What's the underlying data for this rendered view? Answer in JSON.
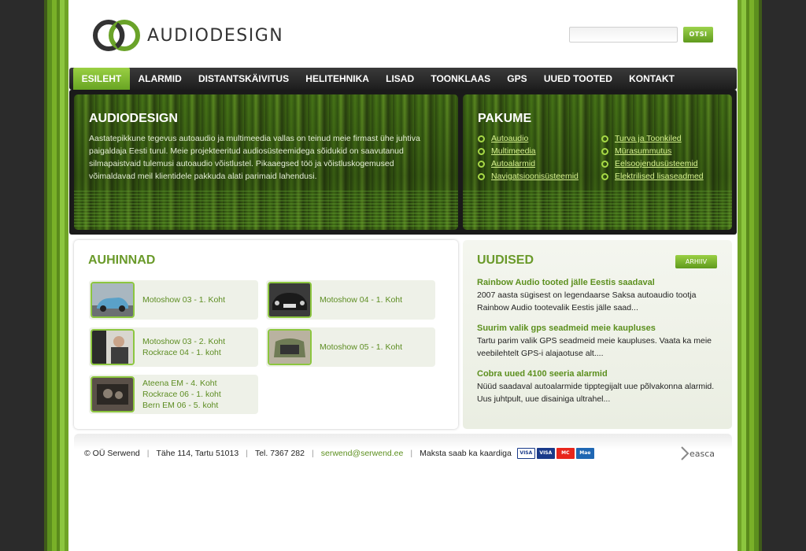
{
  "site": {
    "logo_text": "AUDIODESIGN",
    "search": {
      "placeholder": "",
      "button_label": "OTSI"
    }
  },
  "nav": {
    "items": [
      "ESILEHT",
      "ALARMID",
      "DISTANTSKÄIVITUS",
      "HELITEHNIKA",
      "LISAD",
      "TOONKLAAS",
      "GPS",
      "UUED TOOTED",
      "KONTAKT"
    ],
    "active": "ESILEHT"
  },
  "intro": {
    "title": "AUDIODESIGN",
    "text": "Aastatepikkune tegevus autoaudio ja multimeedia vallas on teinud meie firmast ühe juhtiva paigaldaja Eesti turul. Meie projekteeritud audiosüsteemidega sõidukid on saavutanud silmapaistvaid tulemusi autoaudio võistlustel. Pikaaegsed töö ja võistluskogemused võimaldavad meil klientidele pakkuda alati parimaid lahendusi."
  },
  "offers": {
    "title": "PAKUME",
    "items": [
      "Autoaudio",
      "Turva ja Toonkiled",
      "Multimeedia",
      "Mürasummutus",
      "Autoalarmid",
      "Eelsoojendusüsteemid",
      "Navigatsioonisüsteemid",
      "Elektrilised lisaseadmed"
    ]
  },
  "awards": {
    "title": "AUHINNAD",
    "items": [
      {
        "lines": [
          "Motoshow 03 - 1. Koht"
        ]
      },
      {
        "lines": [
          "Motoshow 04 - 1. Koht"
        ]
      },
      {
        "lines": [
          "Motoshow 03 - 2. Koht",
          "Rockrace 04 - 1. koht"
        ]
      },
      {
        "lines": [
          "Motoshow 05 - 1. Koht"
        ]
      },
      {
        "lines": [
          "Ateena EM - 4. Koht",
          "Rockrace 06 - 1. koht",
          "Bern EM 06 - 5. koht"
        ]
      }
    ]
  },
  "news": {
    "title": "UUDISED",
    "archive_label": "ARHIIV",
    "items": [
      {
        "title": "Rainbow Audio tooted jälle Eestis saadaval",
        "body": "2007 aasta sügisest on legendaarse Saksa autoaudio tootja Rainbow Audio tootevalik Eestis jälle saad..."
      },
      {
        "title": "Suurim valik gps seadmeid meie kaupluses",
        "body": "Tartu parim valik GPS seadmeid meie kaupluses. Vaata ka meie veebilehtelt GPS-i alajaotuse alt...."
      },
      {
        "title": "Cobra uued 4100 seeria alarmid",
        "body": "Nüüd saadaval autoalarmide tipptegijalt uue põlvakonna alarmid. Uus juhtpult, uue disainiga ultrahel..."
      }
    ]
  },
  "footer": {
    "company": "© OÜ Serwend",
    "address": "Tähe 114, Tartu 51013",
    "phone": "Tel. 7367 282",
    "email": "serwend@serwend.ee",
    "payment": "Maksta saab ka kaardiga",
    "cards": [
      "VISA",
      "VISA Electron",
      "MasterCard",
      "Maestro"
    ],
    "credit": "easca"
  },
  "colors": {
    "accent": "#8cc63f",
    "accent_dark": "#5c8f1e",
    "nav_bg": "#222222"
  }
}
